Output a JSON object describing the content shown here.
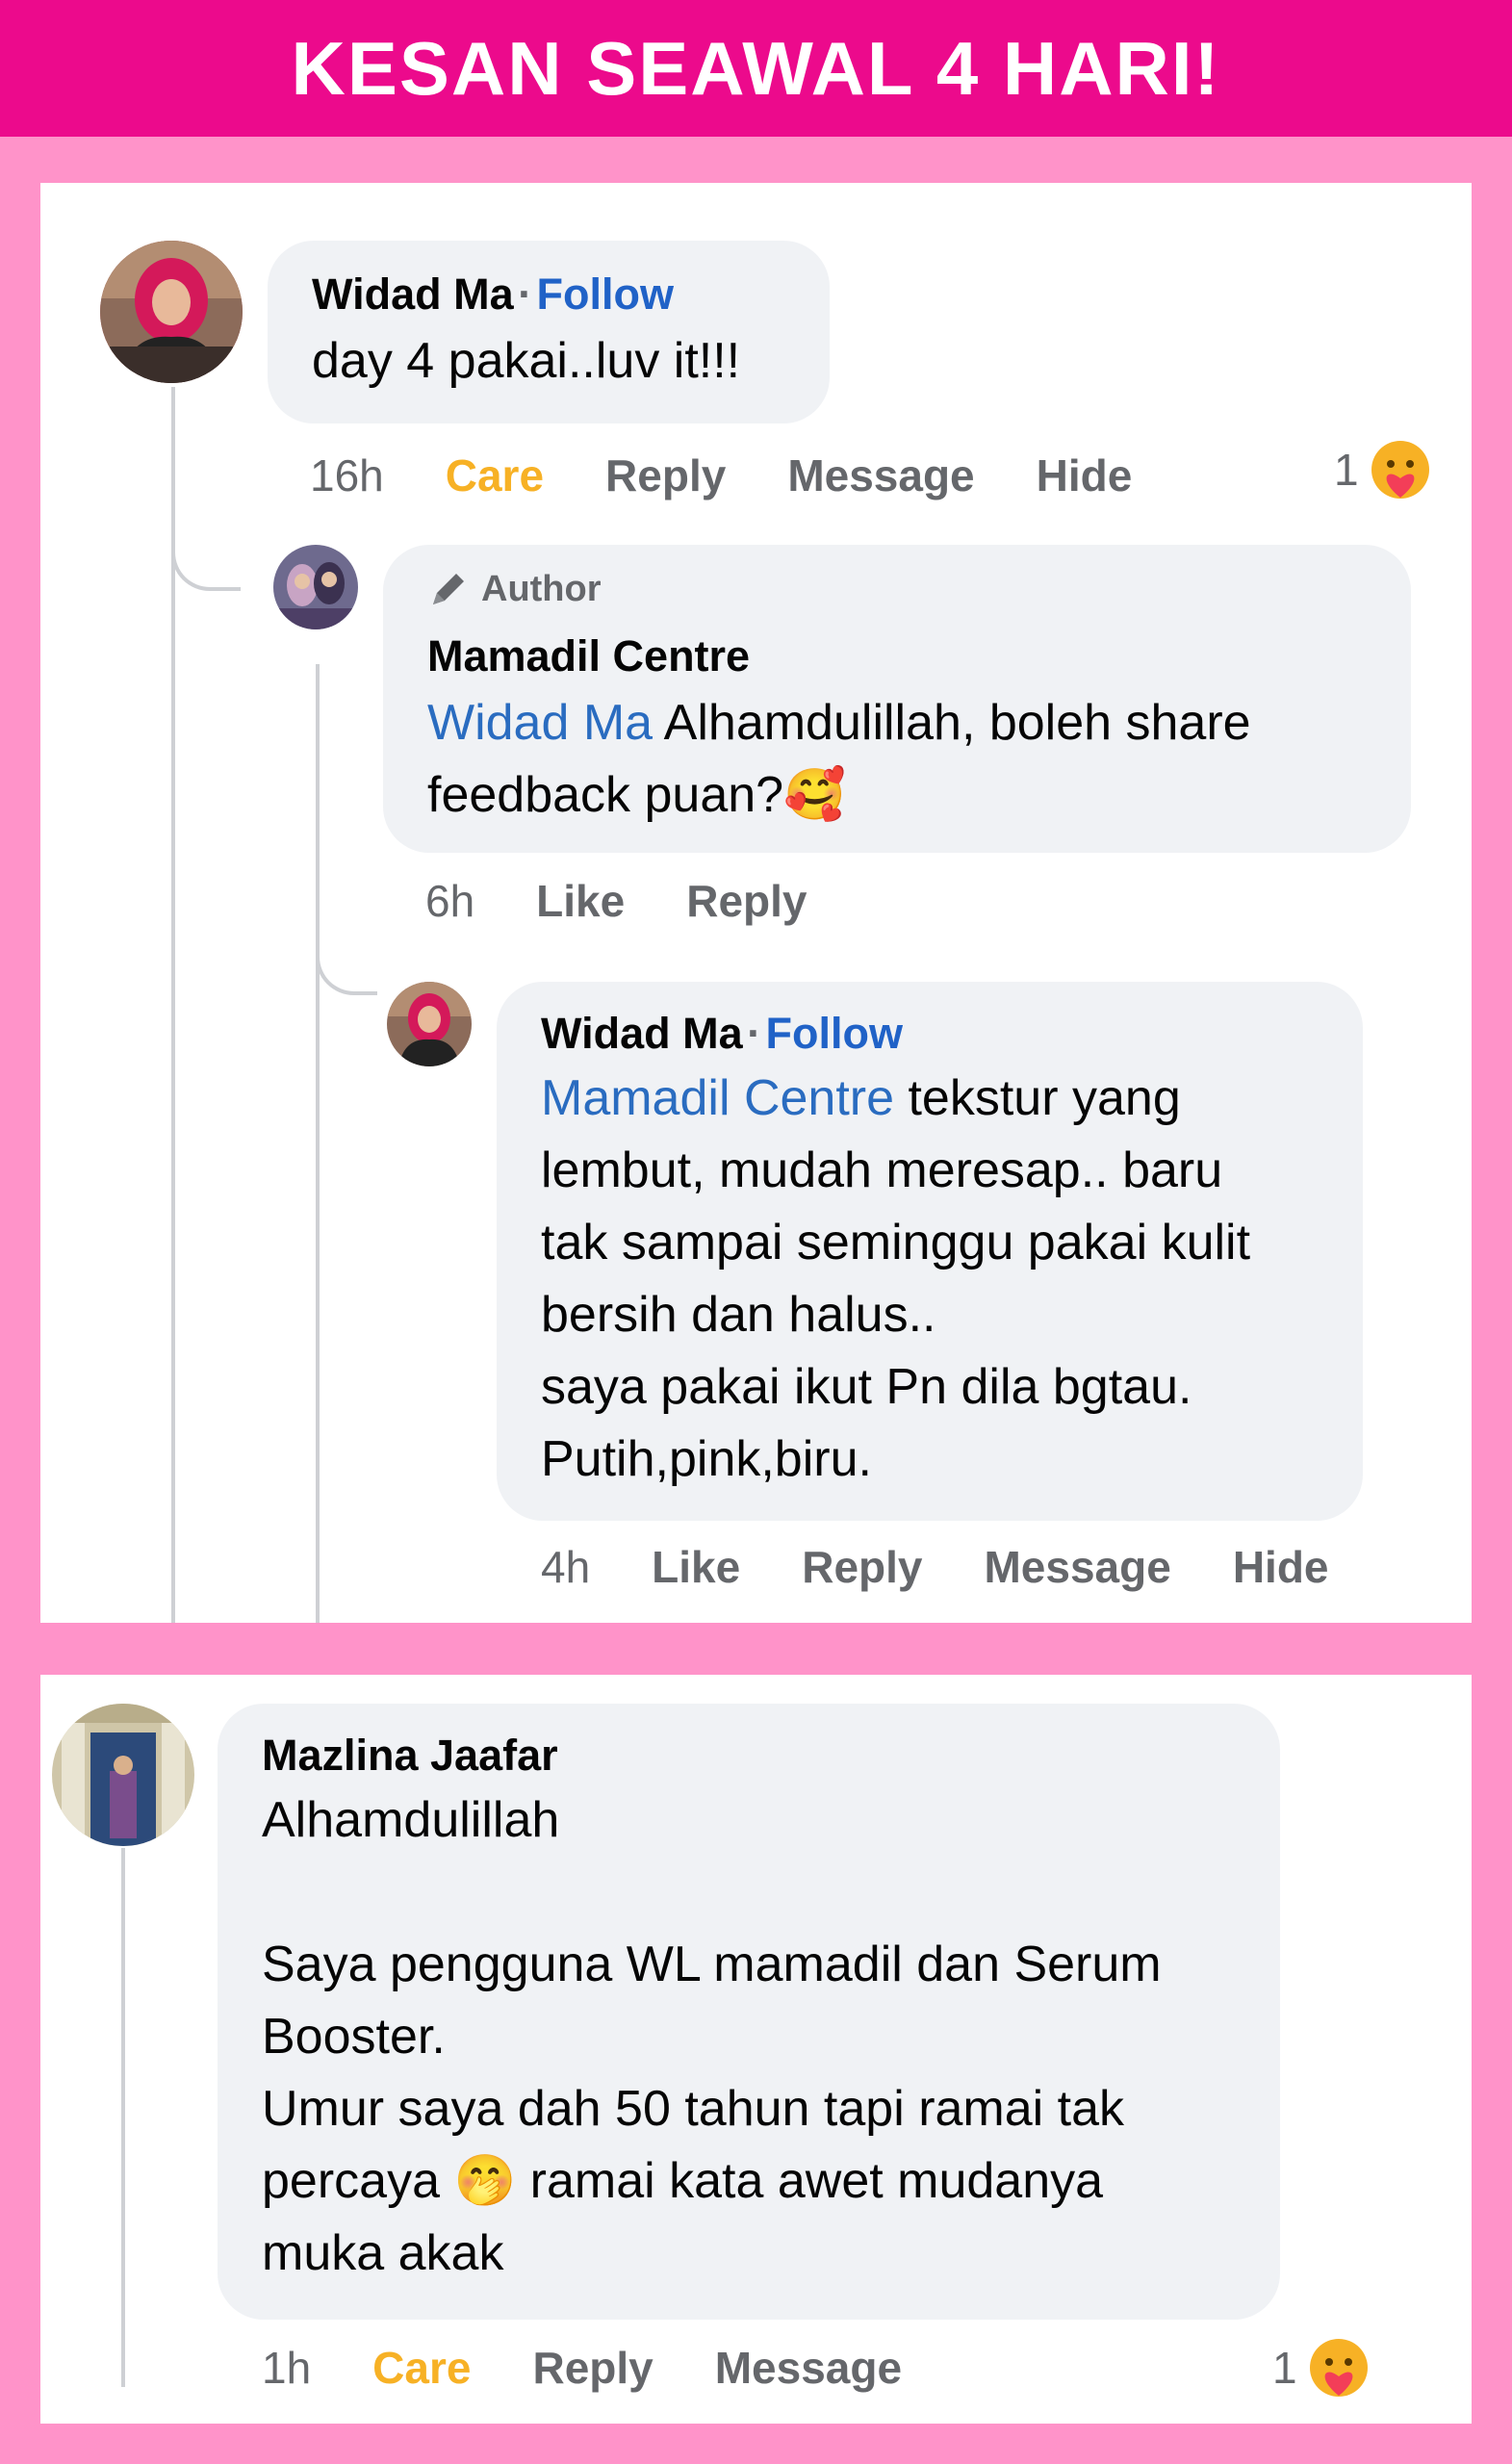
{
  "banner": {
    "title": "KESAN SEAWAL 4 HARI!"
  },
  "colors": {
    "banner_bg": "#ec0a8c",
    "page_bg": "#ff93c9",
    "link": "#2a6cc0",
    "care": "#f7b125"
  },
  "comment1": {
    "name": "Widad Ma",
    "separator": "·",
    "follow": "Follow",
    "text": "day 4 pakai..luv it!!!",
    "time": "16h",
    "actions": [
      "Care",
      "Reply",
      "Message",
      "Hide"
    ],
    "reaction_count": "1",
    "reaction_icon": "care-emoji-icon"
  },
  "reply1": {
    "badge": "Author",
    "badge_icon": "pencil-icon",
    "name": "Mamadil Centre",
    "mention": "Widad Ma",
    "text_line1": " Alhamdulillah, boleh share",
    "text_line2": "feedback puan?",
    "emoji": "🥰",
    "time": "6h",
    "actions": [
      "Like",
      "Reply"
    ]
  },
  "reply2": {
    "name": "Widad Ma",
    "separator": "·",
    "follow": "Follow",
    "mention": "Mamadil Centre",
    "lines": [
      " tekstur yang",
      "lembut, mudah meresap.. baru",
      "tak sampai seminggu pakai kulit",
      "bersih dan halus..",
      "saya pakai ikut Pn dila bgtau.",
      "Putih,pink,biru."
    ],
    "time": "4h",
    "actions": [
      "Like",
      "Reply",
      "Message",
      "Hide"
    ]
  },
  "comment2": {
    "name": "Mazlina Jaafar",
    "lines": [
      "Alhamdulillah",
      "",
      "Saya pengguna WL mamadil dan Serum",
      "Booster.",
      "Umur saya dah 50 tahun tapi ramai tak"
    ],
    "line6_pre": "percaya ",
    "emoji": "🤭",
    "line6_post": " ramai kata awet mudanya",
    "line7": "muka akak",
    "time": "1h",
    "actions": [
      "Care",
      "Reply",
      "Message"
    ],
    "reaction_count": "1",
    "reaction_icon": "care-emoji-icon"
  }
}
